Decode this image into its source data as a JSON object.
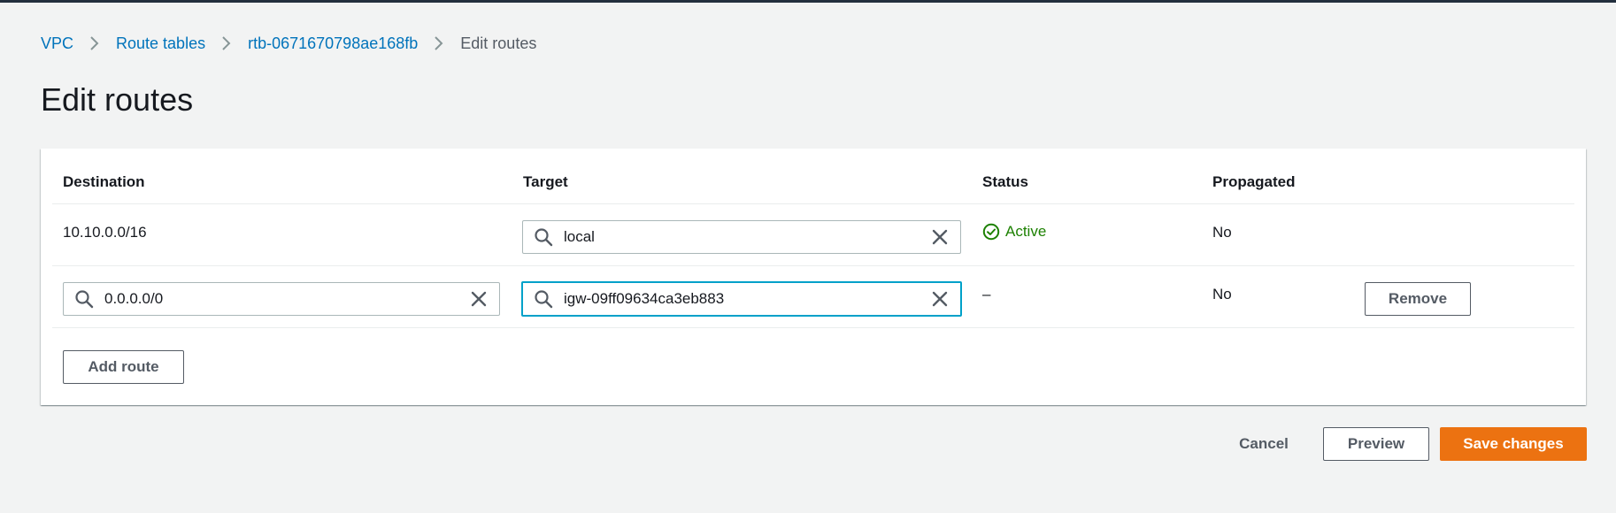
{
  "breadcrumb": {
    "items": [
      "VPC",
      "Route tables",
      "rtb-0671670798ae168fb"
    ],
    "current": "Edit routes"
  },
  "page_title": "Edit routes",
  "table": {
    "headers": {
      "destination": "Destination",
      "target": "Target",
      "status": "Status",
      "propagated": "Propagated"
    },
    "rows": [
      {
        "destination": "10.10.0.0/16",
        "target": "local",
        "status": "Active",
        "propagated": "No"
      },
      {
        "destination": "0.0.0.0/0",
        "target": "igw-09ff09634ca3eb883",
        "status": "–",
        "propagated": "No",
        "remove_label": "Remove"
      }
    ],
    "add_route_label": "Add route"
  },
  "footer": {
    "cancel_label": "Cancel",
    "preview_label": "Preview",
    "save_label": "Save changes"
  },
  "icons": {
    "chevron": "chevron-right-icon",
    "search": "search-icon",
    "clear": "close-icon",
    "status": "status-positive-icon"
  },
  "colors": {
    "link": "#0073bb",
    "active": "#1d8102",
    "primary": "#ec7211",
    "focus": "#00a1c9"
  }
}
